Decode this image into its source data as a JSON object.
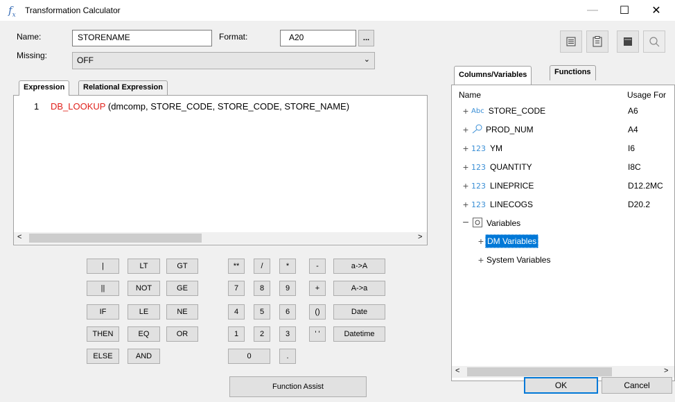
{
  "window": {
    "title": "Transformation Calculator",
    "icon": "fx-icon",
    "minimize": "—",
    "maximize": "☐",
    "close": "✕"
  },
  "form": {
    "name_label": "Name:",
    "name_value": "STORENAME",
    "format_label": "Format:",
    "format_value": "A20",
    "format_browse": "...",
    "missing_label": "Missing:",
    "missing_value": "OFF"
  },
  "tabs_left": [
    {
      "label": "Expression",
      "active": true
    },
    {
      "label": "Relational Expression",
      "active": false
    }
  ],
  "editor": {
    "line_number": "1",
    "function": "DB_LOOKUP",
    "args": " (dmcomp, STORE_CODE, STORE_CODE, STORE_NAME)"
  },
  "calc_buttons": {
    "c1": [
      "|",
      "||",
      "IF",
      "THEN",
      "ELSE"
    ],
    "c2": [
      "LT",
      "NOT",
      "LE",
      "EQ",
      "AND"
    ],
    "c3": [
      "GT",
      "GE",
      "NE",
      "OR"
    ],
    "ops": [
      "**",
      "/",
      "*",
      "-",
      "+",
      "()",
      "' '"
    ],
    "digits": [
      "7",
      "8",
      "9",
      "4",
      "5",
      "6",
      "1",
      "2",
      "3",
      "0",
      "."
    ],
    "wide": [
      "a->A",
      "A->a",
      "Date",
      "Datetime"
    ]
  },
  "function_assist": "Function Assist",
  "tabs_right": [
    {
      "label": "Columns/Variables",
      "active": true
    },
    {
      "label": "Functions",
      "active": false
    }
  ],
  "tree": {
    "col_name": "Name",
    "col_usage": "Usage For",
    "rows": [
      {
        "name": "STORE_CODE",
        "icon": "Abc",
        "usage": "A6"
      },
      {
        "name": "PROD_NUM",
        "icon": "key",
        "usage": "A4"
      },
      {
        "name": "YM",
        "icon": "123",
        "usage": "I6"
      },
      {
        "name": "QUANTITY",
        "icon": "123",
        "usage": "I8C"
      },
      {
        "name": "LINEPRICE",
        "icon": "123",
        "usage": "D12.2MC"
      },
      {
        "name": "LINECOGS",
        "icon": "123",
        "usage": "D20.2"
      }
    ],
    "variables": "Variables",
    "dm_variables": "DM Variables",
    "system_variables": "System Variables"
  },
  "buttons": {
    "ok": "OK",
    "cancel": "Cancel"
  },
  "colors": {
    "function_red": "#e0201a",
    "selection_blue": "#0078d7",
    "icon_blue": "#3a8fd6"
  }
}
